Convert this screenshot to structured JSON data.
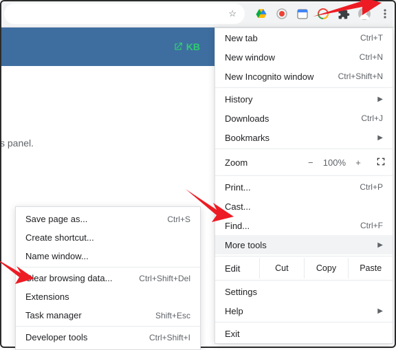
{
  "toolbar": {
    "star": "☆"
  },
  "blueband": {
    "kb_label": "KB"
  },
  "page": {
    "panel_text": "s panel."
  },
  "menu": {
    "new_tab": "New tab",
    "new_tab_sc": "Ctrl+T",
    "new_window": "New window",
    "new_window_sc": "Ctrl+N",
    "new_incognito": "New Incognito window",
    "new_incognito_sc": "Ctrl+Shift+N",
    "history": "History",
    "downloads": "Downloads",
    "downloads_sc": "Ctrl+J",
    "bookmarks": "Bookmarks",
    "zoom": "Zoom",
    "zoom_minus": "−",
    "zoom_value": "100%",
    "zoom_plus": "+",
    "print": "Print...",
    "print_sc": "Ctrl+P",
    "cast": "Cast...",
    "find": "Find...",
    "find_sc": "Ctrl+F",
    "more_tools": "More tools",
    "edit": "Edit",
    "cut": "Cut",
    "copy": "Copy",
    "paste": "Paste",
    "settings": "Settings",
    "help": "Help",
    "exit": "Exit"
  },
  "submenu": {
    "save_page": "Save page as...",
    "save_page_sc": "Ctrl+S",
    "create_shortcut": "Create shortcut...",
    "name_window": "Name window...",
    "clear_data": "Clear browsing data...",
    "clear_data_sc": "Ctrl+Shift+Del",
    "extensions": "Extensions",
    "task_manager": "Task manager",
    "task_manager_sc": "Shift+Esc",
    "dev_tools": "Developer tools",
    "dev_tools_sc": "Ctrl+Shift+I"
  }
}
